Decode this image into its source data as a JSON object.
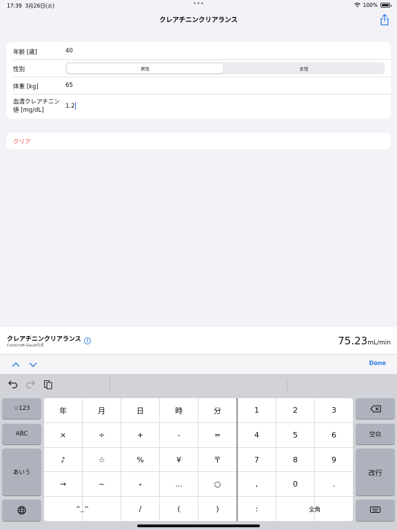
{
  "status_bar": {
    "time": "17:39",
    "date": "3月26日(火)",
    "battery": "100%"
  },
  "nav": {
    "title": "クレアチニンクリアランス"
  },
  "form": {
    "age": {
      "label": "年齢 [歳]",
      "value": "40"
    },
    "sex": {
      "label": "性別",
      "options": [
        "男性",
        "女性"
      ],
      "selected": "男性"
    },
    "weight": {
      "label": "体重 [kg]",
      "value": "65"
    },
    "creatinine": {
      "label_line1": "血清クレアチニン",
      "label_line2": "値 [mg/dL]",
      "value": "1.2"
    }
  },
  "clear": {
    "label": "クリア"
  },
  "result": {
    "title": "クレアチニンクリアランス",
    "subtitle": "Cockcroft-Gaultの式",
    "value": "75.23",
    "unit": "mL/min"
  },
  "accessory": {
    "done_label": "Done"
  },
  "keyboard": {
    "left_keys": [
      "☆123",
      "ABC",
      "あいう"
    ],
    "right_keys": {
      "space": "空白",
      "return": "改行"
    },
    "grid_rows": [
      [
        "年",
        "月",
        "日",
        "時",
        "分",
        "1",
        "2",
        "3"
      ],
      [
        "×",
        "÷",
        "+",
        "-",
        "=",
        "4",
        "5",
        "6"
      ],
      [
        "♪",
        "☆",
        "%",
        "¥",
        "〒",
        "7",
        "8",
        "9"
      ],
      [
        "→",
        "~",
        "・",
        "...",
        "○",
        ",",
        "0",
        "."
      ]
    ],
    "bottom_row": {
      "emoticon": "^_^",
      "slash": "/",
      "paren_open": "(",
      "paren_close": ")",
      "colon": ":",
      "zenkaku": "全角"
    }
  },
  "colors": {
    "accent": "#2f7de1",
    "destructive": "#e5534b",
    "background": "#f2f2f7",
    "keyboard_bg": "#d1d3d9"
  }
}
